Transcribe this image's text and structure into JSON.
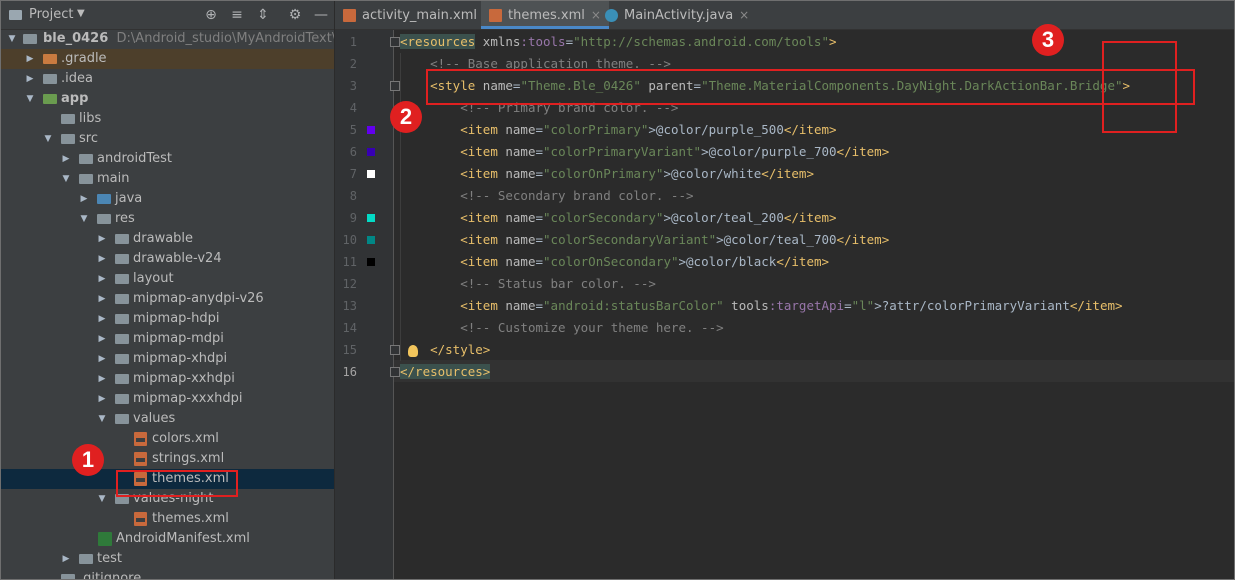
{
  "project_panel": {
    "title": "Project",
    "root_name": "ble_0426",
    "root_path": "D:\\Android_studio\\MyAndroidText\\BlueT",
    "tree": [
      {
        "label": ".gradle"
      },
      {
        "label": ".idea"
      },
      {
        "label": "app"
      },
      {
        "label": "libs"
      },
      {
        "label": "src"
      },
      {
        "label": "androidTest"
      },
      {
        "label": "main"
      },
      {
        "label": "java"
      },
      {
        "label": "res"
      },
      {
        "label": "drawable"
      },
      {
        "label": "drawable-v24"
      },
      {
        "label": "layout"
      },
      {
        "label": "mipmap-anydpi-v26"
      },
      {
        "label": "mipmap-hdpi"
      },
      {
        "label": "mipmap-mdpi"
      },
      {
        "label": "mipmap-xhdpi"
      },
      {
        "label": "mipmap-xxhdpi"
      },
      {
        "label": "mipmap-xxxhdpi"
      },
      {
        "label": "values"
      },
      {
        "label": "colors.xml"
      },
      {
        "label": "strings.xml"
      },
      {
        "label": "themes.xml"
      },
      {
        "label": "values-night"
      },
      {
        "label": "themes.xml"
      },
      {
        "label": "AndroidManifest.xml"
      },
      {
        "label": "test"
      },
      {
        "label": ".gitignore"
      }
    ],
    "icons": [
      "target-icon",
      "collapse-all-icon",
      "expand-icon",
      "gear-icon",
      "minimize-icon"
    ]
  },
  "tabs": [
    {
      "label": "activity_main.xml",
      "close": "×"
    },
    {
      "label": "themes.xml",
      "close": "×"
    },
    {
      "label": "MainActivity.java",
      "close": "×"
    }
  ],
  "editor": {
    "line_numbers": [
      "1",
      "2",
      "3",
      "4",
      "5",
      "6",
      "7",
      "8",
      "9",
      "10",
      "11",
      "12",
      "13",
      "14",
      "15",
      "16"
    ],
    "swatch_colors": {
      "purple_500": "#6200ee",
      "purple_700": "#3700b3",
      "white": "#ffffff",
      "teal_200": "#03dac5",
      "teal_700": "#018786",
      "black": "#000000"
    },
    "lines": {
      "l1": {
        "open": "<resources",
        "attr": " xmlns",
        "ns": ":tools",
        "eq": "=",
        "val": "\"http://schemas.android.com/tools\"",
        "close": ">"
      },
      "l2": {
        "comment": "<!-- Base application theme. -->"
      },
      "l3": {
        "open": "<style",
        "a1": " name",
        "v1": "\"Theme.Ble_0426\"",
        "a2": " parent",
        "v2": "\"Theme.MaterialComponents.DayNight.DarkActionBar.Bridge\"",
        "close": ">"
      },
      "l4": {
        "comment": "<!-- Primary brand color. -->"
      },
      "l5": {
        "open": "<item",
        "a": " name",
        "v": "\"colorPrimary\"",
        "text": ">@color/purple_500",
        "close": "</item>"
      },
      "l6": {
        "open": "<item",
        "a": " name",
        "v": "\"colorPrimaryVariant\"",
        "text": ">@color/purple_700",
        "close": "</item>"
      },
      "l7": {
        "open": "<item",
        "a": " name",
        "v": "\"colorOnPrimary\"",
        "text": ">@color/white",
        "close": "</item>"
      },
      "l8": {
        "comment": "<!-- Secondary brand color. -->"
      },
      "l9": {
        "open": "<item",
        "a": " name",
        "v": "\"colorSecondary\"",
        "text": ">@color/teal_200",
        "close": "</item>"
      },
      "l10": {
        "open": "<item",
        "a": " name",
        "v": "\"colorSecondaryVariant\"",
        "text": ">@color/teal_700",
        "close": "</item>"
      },
      "l11": {
        "open": "<item",
        "a": " name",
        "v": "\"colorOnSecondary\"",
        "text": ">@color/black",
        "close": "</item>"
      },
      "l12": {
        "comment": "<!-- Status bar color. -->"
      },
      "l13": {
        "open": "<item",
        "a": " name",
        "v": "\"android:statusBarColor\"",
        "a2": " tools",
        "ns2": ":targetApi",
        "v2": "\"l\"",
        "text": ">?attr/colorPrimaryVariant",
        "close": "</item>"
      },
      "l14": {
        "comment": "<!-- Customize your theme here. -->"
      },
      "l15": {
        "close": "</style>"
      },
      "l16": {
        "close": "</resources>"
      }
    }
  },
  "annotations": [
    {
      "number": "1"
    },
    {
      "number": "2"
    },
    {
      "number": "3"
    }
  ]
}
